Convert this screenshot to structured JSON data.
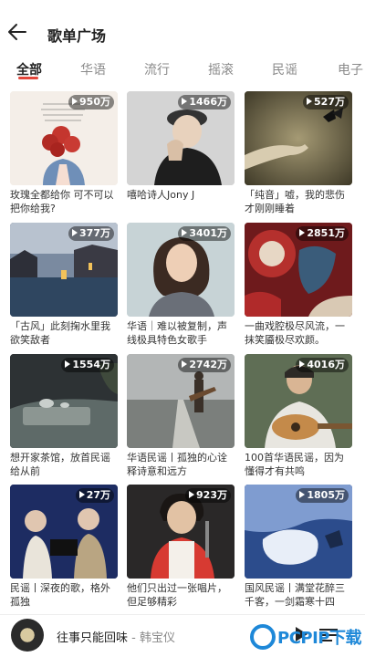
{
  "header": {
    "title": "歌单广场",
    "back_icon": "back-arrow-icon"
  },
  "tabs": [
    {
      "label": "全部",
      "active": true
    },
    {
      "label": "华语",
      "active": false
    },
    {
      "label": "流行",
      "active": false
    },
    {
      "label": "摇滚",
      "active": false
    },
    {
      "label": "民谣",
      "active": false
    },
    {
      "label": "电子",
      "active": false
    }
  ],
  "playlists": [
    {
      "plays": "950万",
      "caption": "玫瑰全都给你 可不可以把你给我?"
    },
    {
      "plays": "1466万",
      "caption": "嘻哈诗人Jony J"
    },
    {
      "plays": "527万",
      "caption": "「纯音」嘘，我的悲伤才刚刚睡着"
    },
    {
      "plays": "377万",
      "caption": "「古风」此刻掬水里我欲笑敌者"
    },
    {
      "plays": "3401万",
      "caption": "华语｜难以被复制，声线极具特色女歌手"
    },
    {
      "plays": "2851万",
      "caption": "一曲戏腔极尽风流，一抹笑靥极尽欢颜。"
    },
    {
      "plays": "1554万",
      "caption": "想开家茶馆，放首民谣给从前"
    },
    {
      "plays": "2742万",
      "caption": "华语民谣丨孤独的心诠释诗意和远方"
    },
    {
      "plays": "4016万",
      "caption": "100首华语民谣，因为懂得才有共鸣"
    },
    {
      "plays": "27万",
      "caption": "民谣丨深夜的歌，格外孤独"
    },
    {
      "plays": "923万",
      "caption": "他们只出过一张唱片，但足够精彩"
    },
    {
      "plays": "1805万",
      "caption": "国风民谣丨满堂花醉三千客，一剑霜寒十四"
    }
  ],
  "player": {
    "song": "往事只能回味",
    "separator": " - ",
    "artist": "韩宝仪"
  },
  "watermark": {
    "text": "PCPIP下载"
  },
  "colors": {
    "accent": "#e2463a",
    "tab_inactive": "#8a8a8a",
    "watermark": "#1e88d8"
  }
}
